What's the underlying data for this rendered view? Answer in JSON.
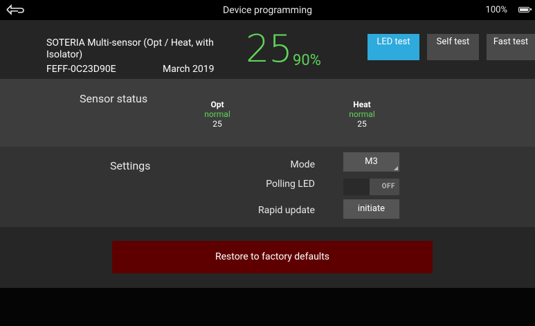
{
  "topbar": {
    "title": "Device programming",
    "battery_percent": "100%"
  },
  "device": {
    "name": "SOTERIA Multi-sensor (Opt / Heat, with Isolator)",
    "id": "FEFF-0C23D90E",
    "date": "March 2019",
    "value": "25",
    "percent": "90%",
    "value_color": "#5fd35a"
  },
  "tests": {
    "led_label": "LED test",
    "self_label": "Self test",
    "fast_label": "Fast test",
    "active_color": "#2eaadc"
  },
  "sensor_status": {
    "title": "Sensor status",
    "sensors": [
      {
        "name": "Opt",
        "state": "normal",
        "value": "25"
      },
      {
        "name": "Heat",
        "state": "normal",
        "value": "25"
      }
    ]
  },
  "settings": {
    "title": "Settings",
    "mode_label": "Mode",
    "mode_value": "M3",
    "polling_label": "Polling LED",
    "polling_value": "OFF",
    "rapid_label": "Rapid update",
    "rapid_button": "initiate"
  },
  "restore": {
    "label": "Restore to factory defaults",
    "color": "#5e0000"
  }
}
